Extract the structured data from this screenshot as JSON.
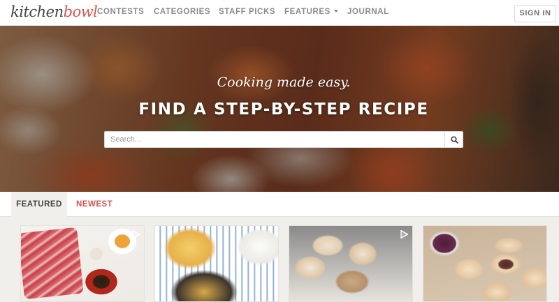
{
  "brand": {
    "logo_part1": "kitchen",
    "logo_part2": "bowl"
  },
  "nav": {
    "links": [
      {
        "label": "CONTESTS"
      },
      {
        "label": "CATEGORIES"
      },
      {
        "label": "STAFF PICKS"
      },
      {
        "label": "FEATURES",
        "has_dropdown": true
      },
      {
        "label": "JOURNAL"
      }
    ],
    "sign_in": "SIGN IN"
  },
  "hero": {
    "tagline": "Cooking made easy.",
    "headline": "FIND A STEP-BY-STEP RECIPE",
    "search_placeholder": "Search...",
    "search_value": ""
  },
  "tabs": [
    {
      "label": "FEATURED",
      "active": true
    },
    {
      "label": "NEWEST",
      "active": false
    }
  ],
  "cards": [
    {
      "image": "raw-beef-ribs-with-sauces",
      "has_video": true
    },
    {
      "image": "noodles-in-skillet",
      "has_video": false
    },
    {
      "image": "frosted-cupcakes",
      "has_video": true
    },
    {
      "image": "sandwich-cookies-with-jam",
      "has_video": false
    }
  ],
  "colors": {
    "accent": "#d9534f",
    "nav_text": "#8a8a8a",
    "page_bg": "#f1efeb"
  }
}
